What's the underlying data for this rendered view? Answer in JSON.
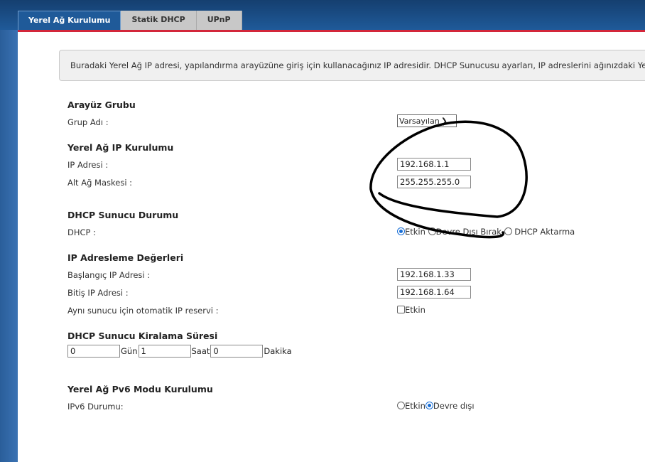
{
  "tabs": [
    {
      "label": "Yerel Ağ Kurulumu",
      "active": true
    },
    {
      "label": "Statik DHCP",
      "active": false
    },
    {
      "label": "UPnP",
      "active": false
    }
  ],
  "notice": "Buradaki Yerel Ağ IP adresi, yapılandırma arayüzüne giriş için kullanacağınız IP adresidir. DHCP Sunucusu ayarları, IP adreslerini ağınızdaki Yer",
  "interface_group": {
    "title": "Arayüz Grubu",
    "group_name_label": "Grup Adı :",
    "group_name_value": "Varsayılan"
  },
  "lan_ip": {
    "title": "Yerel Ağ IP Kurulumu",
    "ip_label": "IP Adresi :",
    "ip_value": "192.168.1.1",
    "mask_label": "Alt Ağ Maskesi :",
    "mask_value": "255.255.255.0"
  },
  "dhcp_status": {
    "title": "DHCP Sunucu Durumu",
    "label": "DHCP :",
    "options": [
      "Etkin",
      "Devre Dışı Bırak",
      "DHCP Aktarma"
    ],
    "selected": "Etkin"
  },
  "addressing": {
    "title": "IP Adresleme Değerleri",
    "start_label": "Başlangıç IP Adresi :",
    "start_value": "192.168.1.33",
    "end_label": "Bitiş IP Adresi :",
    "end_value": "192.168.1.64",
    "reserve_label": "Aynı sunucu için otomatik IP reservi :",
    "reserve_option": "Etkin",
    "reserve_checked": false
  },
  "lease": {
    "title": "DHCP Sunucu Kiralama Süresi",
    "days_value": "0",
    "days_unit": "Gün",
    "hours_value": "1",
    "hours_unit": "Saat",
    "minutes_value": "0",
    "minutes_unit": "Dakika"
  },
  "ipv6": {
    "title": "Yerel Ağ Pv6 Modu Kurulumu",
    "label": "IPv6 Durumu:",
    "options": [
      "Etkin",
      "Devre dışı"
    ],
    "selected": "Devre dışı"
  },
  "colors": {
    "accent_blue": "#1f5a99",
    "tab_underline_red": "#d3263a",
    "radio_selected": "#1a6fd6",
    "scribble": "#000000"
  }
}
